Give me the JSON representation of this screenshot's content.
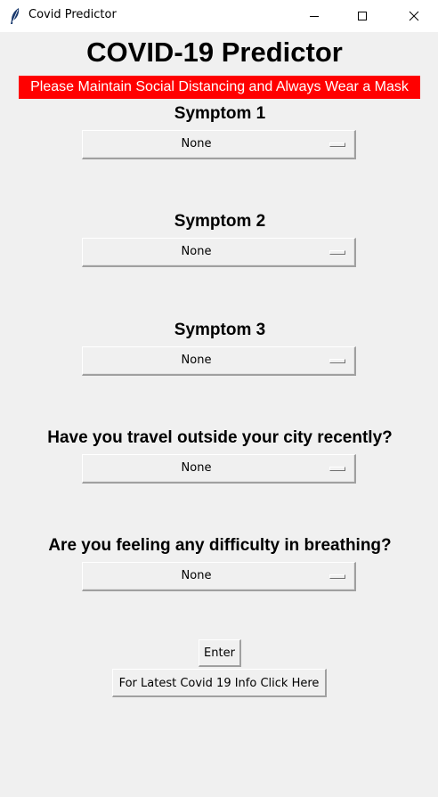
{
  "window": {
    "title": "Covid Predictor",
    "icon": "feather-icon",
    "controls": [
      "minimize-icon",
      "maximize-icon",
      "close-icon"
    ]
  },
  "heading": "COVID-19 Predictor",
  "banner": {
    "text": "Please Maintain Social Distancing and Always Wear a Mask",
    "background": "#ff0000",
    "color": "#ffffff"
  },
  "questions": [
    {
      "label": "Symptom 1",
      "selected": "None"
    },
    {
      "label": "Symptom 2",
      "selected": "None"
    },
    {
      "label": "Symptom 3",
      "selected": "None"
    },
    {
      "label": "Have you travel outside your city recently?",
      "selected": "None"
    },
    {
      "label": "Are you feeling any difficulty in breathing?",
      "selected": "None"
    }
  ],
  "buttons": {
    "enter": "Enter",
    "info": "For Latest Covid 19 Info Click Here"
  }
}
